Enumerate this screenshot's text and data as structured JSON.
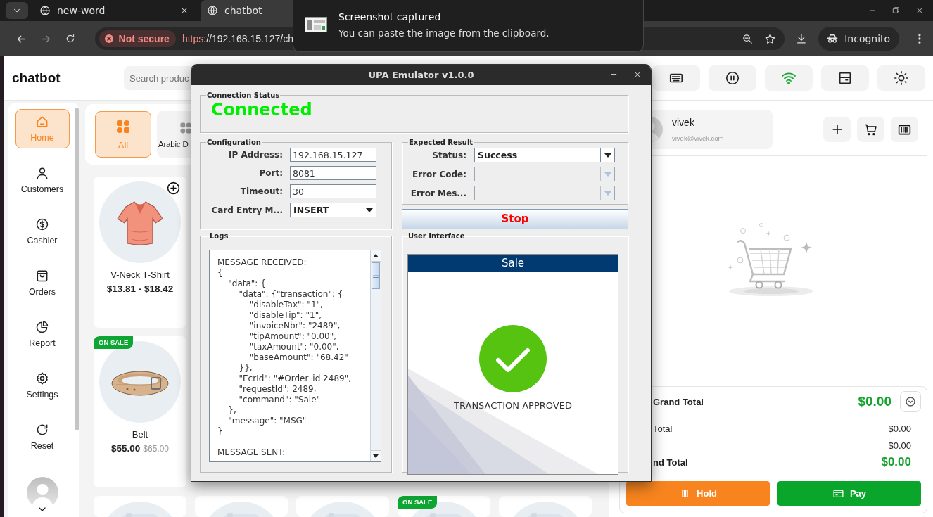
{
  "browser": {
    "tabs": [
      {
        "title": "new-word",
        "selected": false
      },
      {
        "title": "chatbot",
        "selected": true
      }
    ],
    "security_label": "Not secure",
    "url_scheme": "https",
    "url_rest": "://192.168.15.127/ch",
    "profile_label": "Incognito"
  },
  "toast": {
    "title": "Screenshot captured",
    "message": "You can paste the image from the clipboard."
  },
  "app": {
    "brand": "chatbot",
    "search": {
      "placeholder": "Search produc"
    },
    "wifi_connected": true,
    "nav": [
      {
        "label": "Home",
        "selected": true
      },
      {
        "label": "Customers",
        "selected": false
      },
      {
        "label": "Cashier",
        "selected": false
      },
      {
        "label": "Orders",
        "selected": false
      },
      {
        "label": "Report",
        "selected": false
      },
      {
        "label": "Settings",
        "selected": false
      },
      {
        "label": "Reset",
        "selected": false
      }
    ],
    "categories": [
      {
        "label": "All",
        "selected": true
      },
      {
        "label": "Arabic D",
        "selected": false
      }
    ],
    "product_grid": [
      [
        {
          "kind": "product",
          "name": "V-Neck T-Shirt",
          "price": "$13.81 - $18.42",
          "add_button": true
        }
      ],
      [
        {
          "kind": "product",
          "name": "Belt",
          "price": "$55.00",
          "old_price": "$65.00",
          "badge": "ON SALE",
          "add_button": false
        }
      ],
      [
        {
          "kind": "picture"
        },
        {
          "kind": "picture"
        },
        {
          "kind": "picture"
        },
        {
          "kind": "picture",
          "badge": "ON SALE"
        },
        {
          "kind": "picture"
        }
      ]
    ],
    "customer": {
      "name": "vivek",
      "email": "vivek@vivek.com"
    },
    "totals": [
      {
        "kind": "grand",
        "label": "Grand Total",
        "value": "$0.00"
      },
      {
        "kind": "line",
        "label": "Total",
        "value": "$0.00"
      },
      {
        "kind": "line",
        "value": "$0.00"
      },
      {
        "kind": "total",
        "label": "nd Total",
        "value": "$0.00"
      }
    ],
    "actions": [
      {
        "kind": "hold",
        "label": "Hold"
      },
      {
        "kind": "pay",
        "label": "Pay"
      }
    ]
  },
  "emulator": {
    "title": "UPA Emulator v1.0.0",
    "connection": {
      "legend": "Connection Status",
      "status": "Connected"
    },
    "configuration": {
      "legend": "Configuration",
      "fields": [
        {
          "kind": "text",
          "label": "IP Address:",
          "value": "192.168.15.127"
        },
        {
          "kind": "text",
          "label": "Port:",
          "value": "8081"
        },
        {
          "kind": "text",
          "label": "Timeout:",
          "value": "30"
        },
        {
          "kind": "select",
          "label": "Card Entry M...",
          "value": "INSERT"
        }
      ]
    },
    "expected": {
      "legend": "Expected Result",
      "fields": [
        {
          "label": "Status:",
          "value": "Success",
          "disabled": false
        },
        {
          "label": "Error Code:",
          "disabled": true
        },
        {
          "label": "Error Mes...",
          "disabled": true
        }
      ]
    },
    "stop_button": "Stop",
    "logs": {
      "legend": "Logs",
      "text": "MESSAGE RECEIVED:\n{\n    \"data\": {\n        \"data\": {\"transaction\": {\n            \"disableTax\": \"1\",\n            \"disableTip\": \"1\",\n            \"invoiceNbr\": \"2489\",\n            \"tipAmount\": \"0.00\",\n            \"taxAmount\": \"0.00\",\n            \"baseAmount\": \"68.42\"\n        }},\n        \"EcrId\": \"#Order_id 2489\",\n        \"requestId\": 2489,\n        \"command\": \"Sale\"\n    },\n    \"message\": \"MSG\"\n}\n\nMESSAGE SENT:"
    },
    "ui": {
      "legend": "User Interface",
      "header": "Sale",
      "message": "TRANSACTION APPROVED"
    }
  }
}
